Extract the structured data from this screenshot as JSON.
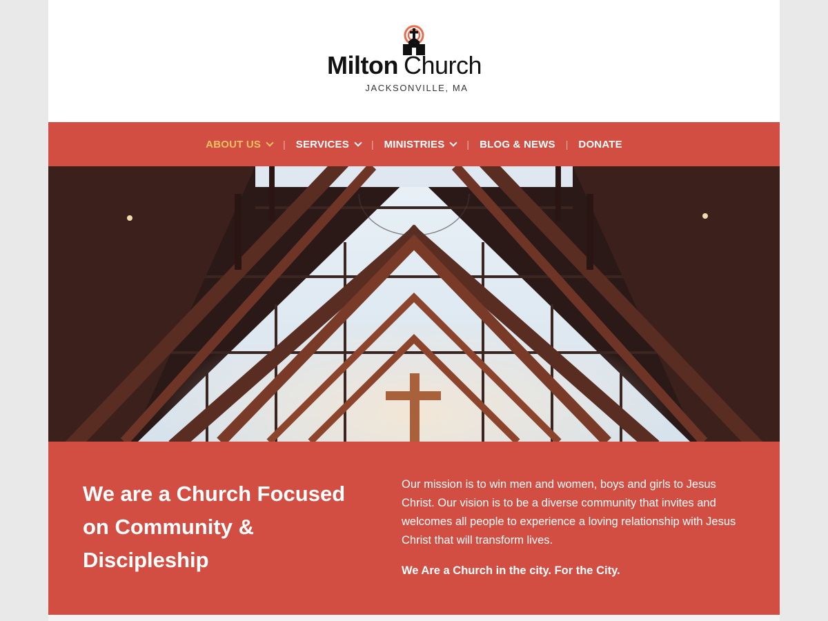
{
  "site": {
    "logo": {
      "name_bold": "Milton",
      "name_regular": "Church",
      "location": "JACKSONVILLE, MA",
      "icon": "church-logo-icon"
    }
  },
  "nav": {
    "items": [
      {
        "label": "ABOUT US",
        "has_dropdown": true,
        "active": true
      },
      {
        "label": "SERVICES",
        "has_dropdown": true,
        "active": false
      },
      {
        "label": "MINISTRIES",
        "has_dropdown": true,
        "active": false
      },
      {
        "label": "BLOG & NEWS",
        "has_dropdown": false,
        "active": false
      },
      {
        "label": "DONATE",
        "has_dropdown": false,
        "active": false
      }
    ],
    "separator": "|"
  },
  "hero": {
    "image_subject": "church-interior-cross-window"
  },
  "intro": {
    "headline": "We are a Church Focused on Community & Discipleship",
    "mission": "Our mission is to win men and women, boys and girls to Jesus Christ. Our vision is to be a diverse community that invites and welcomes all people to experience a loving relationship with Jesus Christ that will transform lives.",
    "tagline": "We Are a Church in the city. For the City."
  },
  "colors": {
    "brand_red": "#d34e42",
    "nav_active": "#f2c062",
    "logo_accent": "#e86b4c",
    "page_background": "#e9e9e9"
  }
}
